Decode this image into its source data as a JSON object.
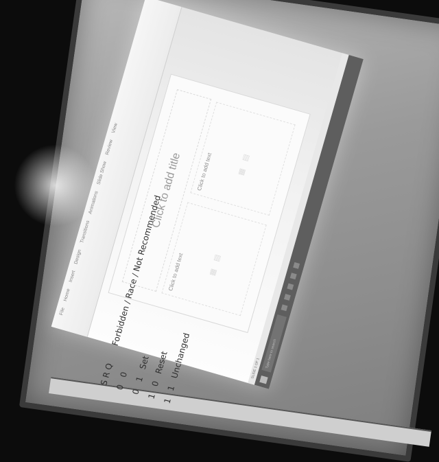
{
  "projection": {
    "ribbon_tabs": [
      "File",
      "Home",
      "Insert",
      "Design",
      "Transitions",
      "Animations",
      "Slide Show",
      "Review",
      "View"
    ],
    "ribbon_note": "",
    "slide": {
      "title_placeholder": "Click to add title",
      "left_body_placeholder": "Click to add text",
      "right_body_placeholder": "Click to add text"
    },
    "status_bar": "SLIDE 1 OF 1",
    "taskbar": {
      "search_placeholder": "Type here to search",
      "tray_text": ""
    }
  },
  "handwritten_notes": {
    "header": "S  R  Q",
    "col_label": "Forbidden / Race / Not Recommended",
    "rows": [
      {
        "s": "0",
        "r": "0",
        "text": ""
      },
      {
        "s": "0",
        "r": "1",
        "text": "Set"
      },
      {
        "s": "1",
        "r": "0",
        "text": "Reset"
      },
      {
        "s": "1",
        "r": "1",
        "text": "Unchanged"
      }
    ]
  }
}
